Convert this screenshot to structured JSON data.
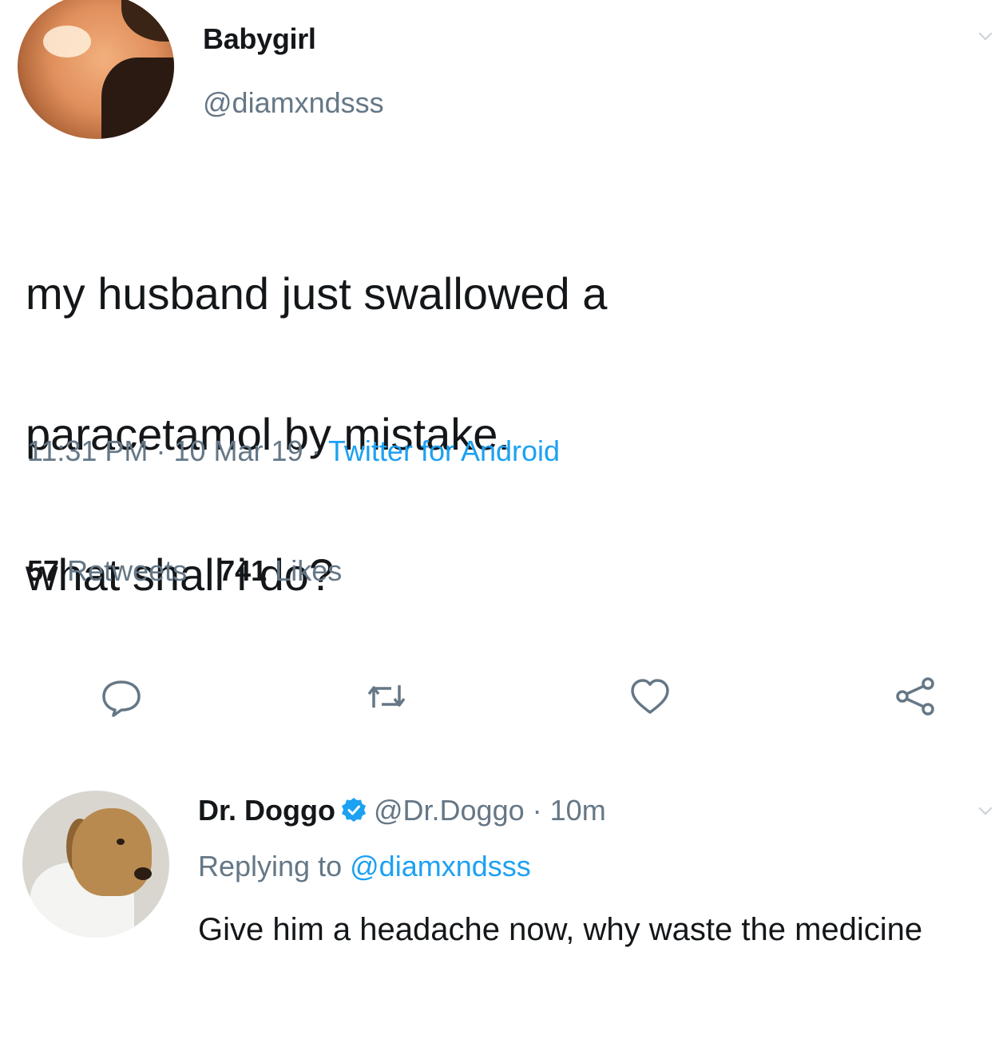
{
  "tweet": {
    "display_name": "Babygirl",
    "handle": "@diamxndsss",
    "text_lines": [
      "my husband just swallowed a",
      "paracetamol by mistake.",
      "what shall i do?"
    ],
    "time": "11:31 PM",
    "date": "10 Mar 19",
    "separator": "·",
    "source": "Twitter for Android",
    "retweets_count": "57",
    "retweets_label": "Retweets",
    "likes_count": "741",
    "likes_label": "Likes",
    "actions": [
      "reply-icon",
      "retweet-icon",
      "like-icon",
      "share-icon"
    ]
  },
  "reply": {
    "display_name": "Dr. Doggo",
    "verified": true,
    "handle": "@Dr.Doggo",
    "separator": "·",
    "time": "10m",
    "replying_prefix": "Replying to",
    "replying_to": "@diamxndsss",
    "text": "Give him a headache now, why waste the medicine"
  },
  "colors": {
    "text": "#14171a",
    "secondary": "#657786",
    "accent": "#1da1f2"
  }
}
